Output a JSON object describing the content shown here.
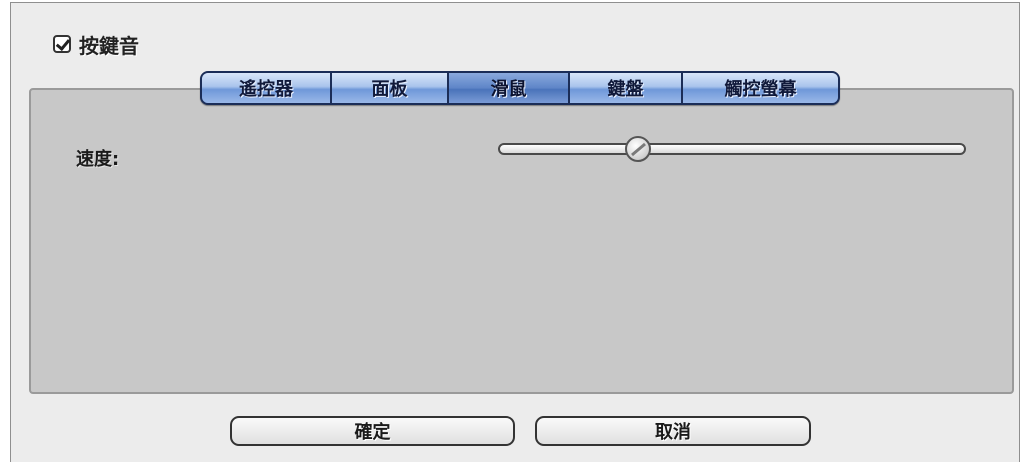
{
  "beep": {
    "label": "按鍵音",
    "checked": true
  },
  "tabs": [
    {
      "label": "遙控器"
    },
    {
      "label": "面板"
    },
    {
      "label": "滑鼠",
      "active": true
    },
    {
      "label": "鍵盤"
    },
    {
      "label": "觸控螢幕"
    }
  ],
  "speed": {
    "label": "速度:",
    "value": 0.3
  },
  "buttons": {
    "ok": "確定",
    "cancel": "取消"
  }
}
